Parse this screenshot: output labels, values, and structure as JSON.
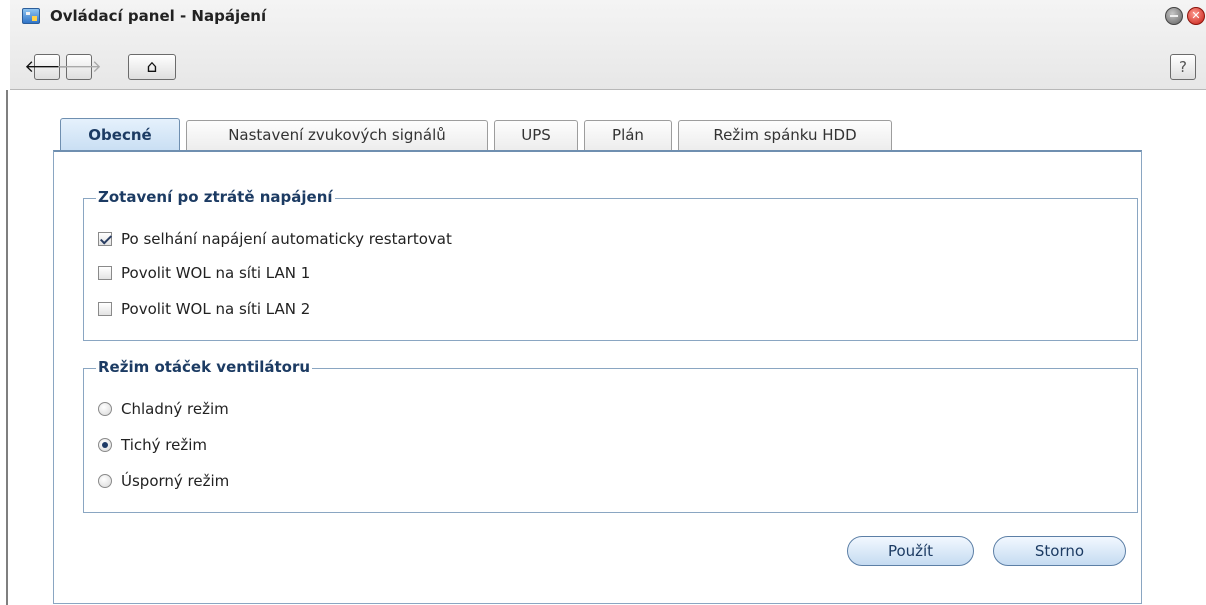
{
  "window": {
    "title": "Ovládací panel - Napájení",
    "close_symbol": "✕"
  },
  "toolbar": {
    "back_icon": "arrow-left-icon",
    "back_symbol": "🡐",
    "forward_icon": "arrow-right-icon",
    "forward_symbol": "🡒",
    "home_icon": "home-icon",
    "home_symbol": "⌂",
    "help_label": "?"
  },
  "tabs": [
    {
      "label": "Obecné",
      "active": true
    },
    {
      "label": "Nastavení zvukových signálů",
      "active": false
    },
    {
      "label": "UPS",
      "active": false
    },
    {
      "label": "Plán",
      "active": false
    },
    {
      "label": "Režim spánku HDD",
      "active": false
    }
  ],
  "power_recovery": {
    "legend": "Zotavení po ztrátě napájení",
    "options": [
      {
        "label": "Po selhání napájení automaticky restartovat",
        "checked": true
      },
      {
        "label": "Povolit WOL na síti LAN 1",
        "checked": false
      },
      {
        "label": "Povolit WOL na síti LAN 2",
        "checked": false
      }
    ]
  },
  "fan_mode": {
    "legend": "Režim otáček ventilátoru",
    "options": [
      {
        "label": "Chladný režim",
        "selected": false
      },
      {
        "label": "Tichý režim",
        "selected": true
      },
      {
        "label": "Úsporný režim",
        "selected": false
      }
    ]
  },
  "buttons": {
    "apply": "Použít",
    "cancel": "Storno"
  },
  "colors": {
    "accent": "#1c3b63",
    "border": "#8aa6c2",
    "close": "#c51b12"
  }
}
